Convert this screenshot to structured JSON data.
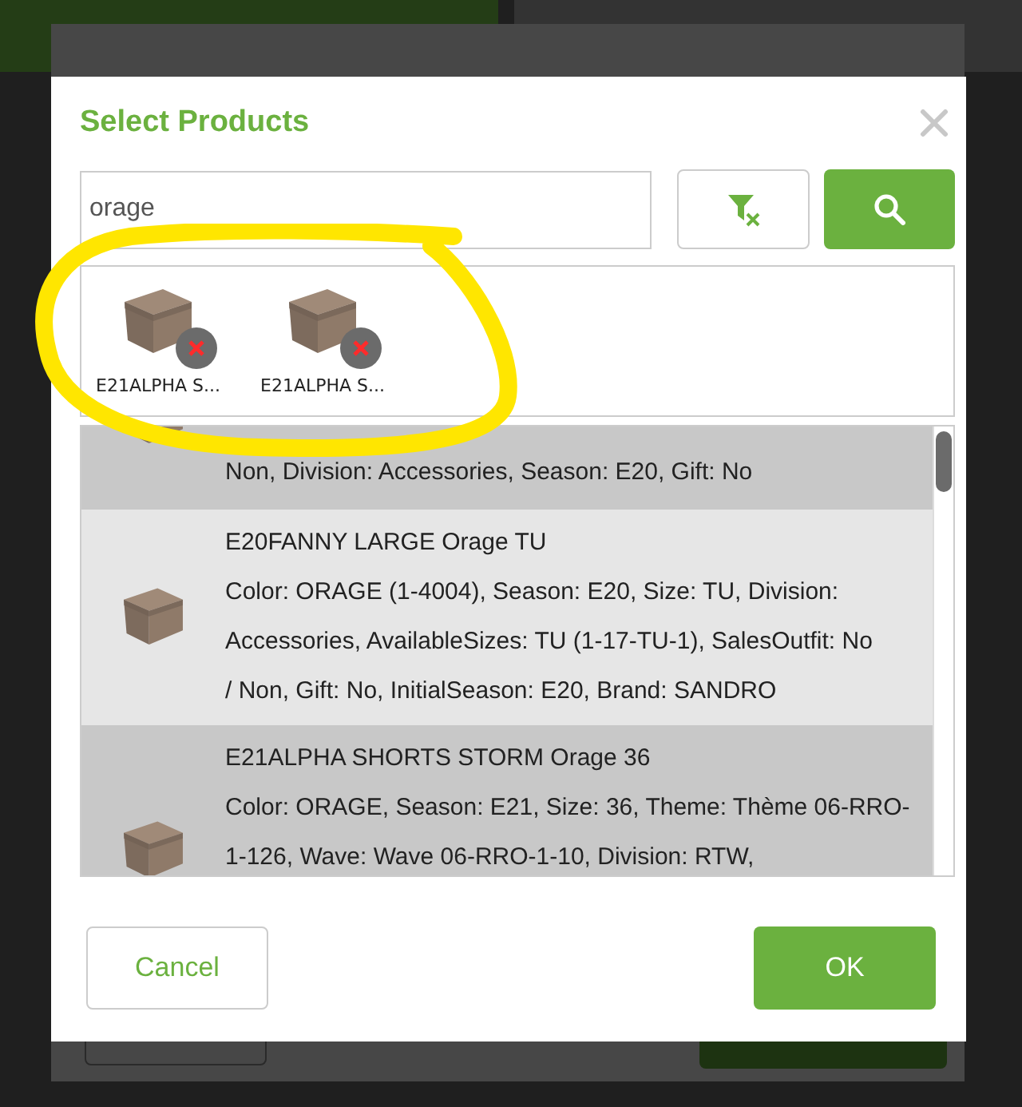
{
  "dialog": {
    "title": "Select Products",
    "search": {
      "value": "orage"
    },
    "selected_products": [
      {
        "label": "E21ALPHA S..."
      },
      {
        "label": "E21ALPHA S..."
      }
    ],
    "results": [
      {
        "selected": true,
        "lines": [
          "Non, Division: Accessories, Season: E20, Gift: No"
        ]
      },
      {
        "selected": false,
        "title": "E20FANNY LARGE Orage TU",
        "lines": [
          "Color: ORAGE (1-4004), Season: E20, Size: TU, Division:",
          "Accessories, AvailableSizes: TU (1-17-TU-1), SalesOutfit: No",
          "/ Non, Gift: No, InitialSeason: E20, Brand: SANDRO"
        ]
      },
      {
        "selected": true,
        "title": "E21ALPHA SHORTS STORM Orage 36",
        "lines": [
          "Color: ORAGE, Season: E21, Size: 36, Theme: Thème 06-RRO-",
          "1-126, Wave: Wave 06-RRO-1-10, Division: RTW,"
        ]
      }
    ],
    "buttons": [
      {
        "kind": "secondary",
        "label": "Cancel"
      },
      {
        "kind": "primary",
        "label": "OK"
      }
    ]
  },
  "annotation": {
    "kind": "highlight"
  }
}
